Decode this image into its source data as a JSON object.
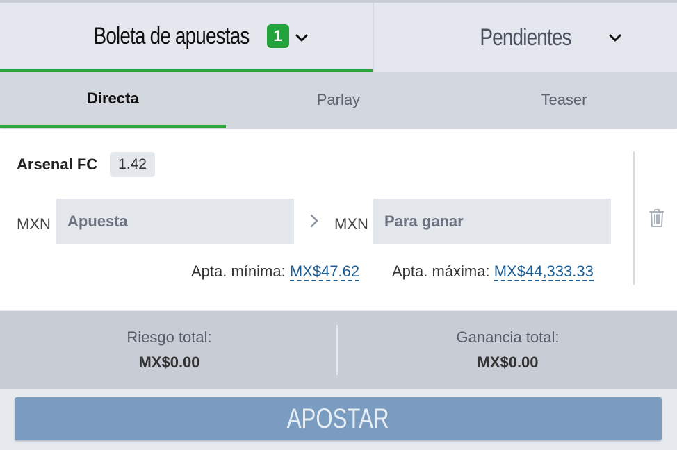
{
  "top_tabs": {
    "slip": {
      "label": "Boleta de apuestas",
      "count": "1"
    },
    "pending": {
      "label": "Pendientes"
    }
  },
  "sub_tabs": [
    "Directa",
    "Parlay",
    "Teaser"
  ],
  "active_sub_tab": "Directa",
  "selection": {
    "name": "Arsenal FC",
    "odds": "1.42",
    "stake": {
      "currency": "MXN",
      "placeholder": "Apuesta",
      "value": ""
    },
    "to_win": {
      "currency": "MXN",
      "placeholder": "Para ganar",
      "value": ""
    },
    "min_label": "Apta. mínima:",
    "min_value": "MX$47.62",
    "max_label": "Apta. máxima:",
    "max_value": "MX$44,333.33"
  },
  "totals": {
    "risk_label": "Riesgo total:",
    "risk_value": "MX$0.00",
    "win_label": "Ganancia total:",
    "win_value": "MX$0.00"
  },
  "place_bet_label": "APOSTAR",
  "colors": {
    "accent_green": "#2ea53a",
    "badge_green": "#23a33b",
    "link_blue": "#1a5e95",
    "button_blue": "#7a9cc0"
  },
  "icons": [
    "chevron-down-icon",
    "chevron-right-icon",
    "trash-icon"
  ]
}
